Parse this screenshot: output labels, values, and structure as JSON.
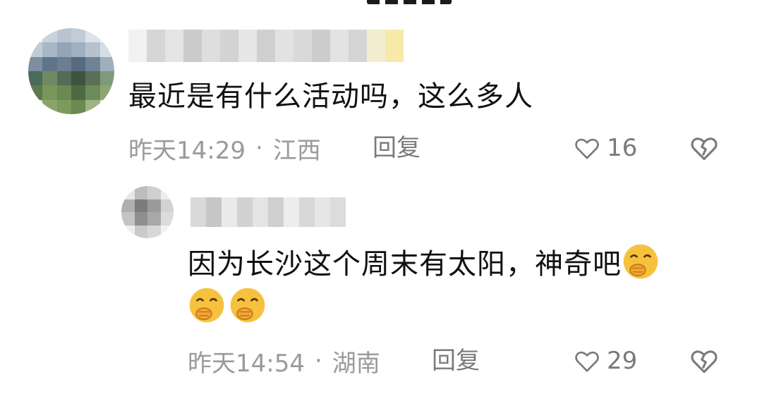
{
  "comment": {
    "text": "最近是有什么活动吗，这么多人",
    "time": "昨天14:29",
    "location": "江西",
    "reply_label": "回复",
    "likes": "16"
  },
  "reply": {
    "text": "因为长沙这个周末有太阳，神奇吧",
    "time": "昨天14:54",
    "location": "湖南",
    "reply_label": "回复",
    "likes": "29",
    "emoji_count": 3,
    "emoji_name": "cover-mouth-smile-emoji"
  },
  "colors": {
    "meta": "#9a9a9a",
    "action": "#7a7a7a",
    "text": "#111111",
    "emoji": "#f6c23e"
  },
  "icons": [
    "heart-outline-icon",
    "broken-heart-icon",
    "cover-mouth-smile-emoji"
  ]
}
